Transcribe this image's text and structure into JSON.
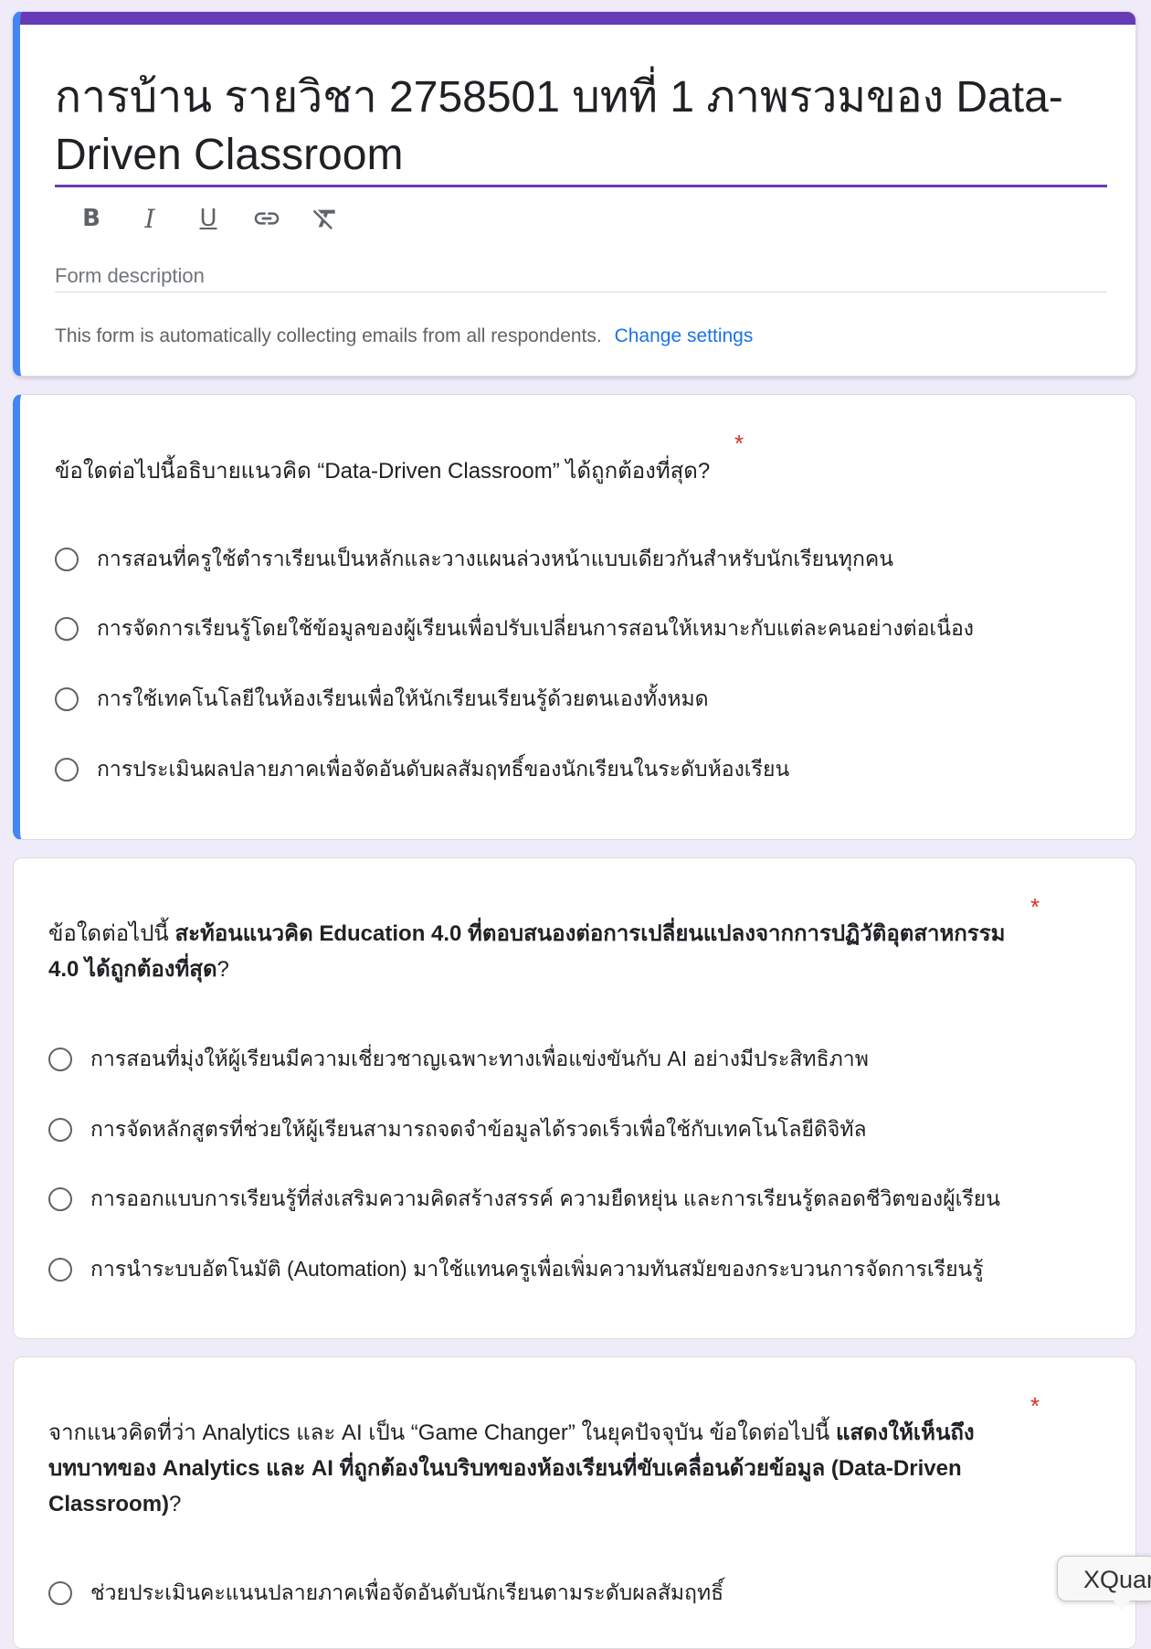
{
  "form": {
    "title": "การบ้าน รายวิชา 2758501 บทที่ 1 ภาพรวมของ Data-Driven Classroom",
    "description_placeholder": "Form description",
    "email_note": "This form is automatically collecting emails from all respondents.",
    "change_settings_label": "Change settings",
    "accent_color": "#673ab7",
    "focus_color": "#4285f4"
  },
  "toolbar": {
    "bold": "B",
    "italic": "I",
    "underline": "U",
    "link_icon": "link-icon",
    "clear_format_icon": "clear-formatting-icon"
  },
  "questions": [
    {
      "text_plain": "ข้อใดต่อไปนี้อธิบายแนวคิด “Data-Driven Classroom” ได้ถูกต้องที่สุด?",
      "required_mark": "*",
      "options": [
        "การสอนที่ครูใช้ตำราเรียนเป็นหลักและวางแผนล่วงหน้าแบบเดียวกันสำหรับนักเรียนทุกคน",
        "การจัดการเรียนรู้โดยใช้ข้อมูลของผู้เรียนเพื่อปรับเปลี่ยนการสอนให้เหมาะกับแต่ละคนอย่างต่อเนื่อง",
        "การใช้เทคโนโลยีในห้องเรียนเพื่อให้นักเรียนเรียนรู้ด้วยตนเองทั้งหมด",
        "การประเมินผลปลายภาคเพื่อจัดอันดับผลสัมฤทธิ์ของนักเรียนในระดับห้องเรียน"
      ]
    },
    {
      "text_plain_start": "ข้อใดต่อไปนี้ ",
      "text_bold": "สะท้อนแนวคิด Education 4.0 ที่ตอบสนองต่อการเปลี่ยนแปลงจากการปฏิวัติอุตสาหกรรม 4.0 ได้ถูกต้องที่สุด",
      "text_plain_end": "?",
      "required_mark": "*",
      "options": [
        "การสอนที่มุ่งให้ผู้เรียนมีความเชี่ยวชาญเฉพาะทางเพื่อแข่งขันกับ AI อย่างมีประสิทธิภาพ",
        "การจัดหลักสูตรที่ช่วยให้ผู้เรียนสามารถจดจำข้อมูลได้รวดเร็วเพื่อใช้กับเทคโนโลยีดิจิทัล",
        "การออกแบบการเรียนรู้ที่ส่งเสริมความคิดสร้างสรรค์ ความยืดหยุ่น และการเรียนรู้ตลอดชีวิตของผู้เรียน",
        "การนำระบบอัตโนมัติ (Automation) มาใช้แทนครูเพื่อเพิ่มความทันสมัยของกระบวนการจัดการเรียนรู้"
      ]
    },
    {
      "text_plain_start": "จากแนวคิดที่ว่า Analytics และ AI เป็น “Game Changer” ในยุคปัจจุบัน ข้อใดต่อไปนี้ ",
      "text_bold": "แสดงให้เห็นถึงบทบาทของ Analytics และ AI ที่ถูกต้องในบริบทของห้องเรียนที่ขับเคลื่อนด้วยข้อมูล (Data-Driven Classroom)",
      "text_plain_end": "?",
      "required_mark": "*",
      "options": [
        "ช่วยประเมินคะแนนปลายภาคเพื่อจัดอันดับนักเรียนตามระดับผลสัมฤทธิ์"
      ]
    }
  ],
  "overlay": {
    "tooltip_text": "XQuartz"
  }
}
